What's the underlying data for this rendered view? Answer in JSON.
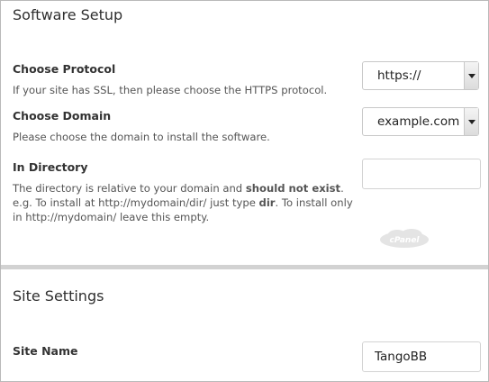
{
  "software_setup": {
    "title": "Software Setup",
    "protocol": {
      "label": "Choose Protocol",
      "description": "If your site has SSL, then please choose the HTTPS protocol.",
      "selected": "https://"
    },
    "domain": {
      "label": "Choose Domain",
      "description": "Please choose the domain to install the software.",
      "selected": "example.com"
    },
    "directory": {
      "label": "In Directory",
      "desc_1": "The directory is relative to your domain and ",
      "desc_bold_1": "should not exist",
      "desc_2": ". e.g. To install at http://mydomain/dir/ just type ",
      "desc_bold_2": "dir",
      "desc_3": ". To install only in http://mydomain/ leave this empty.",
      "value": ""
    },
    "watermark": "cPanel"
  },
  "site_settings": {
    "title": "Site Settings",
    "site_name": {
      "label": "Site Name",
      "value": "TangoBB"
    }
  }
}
